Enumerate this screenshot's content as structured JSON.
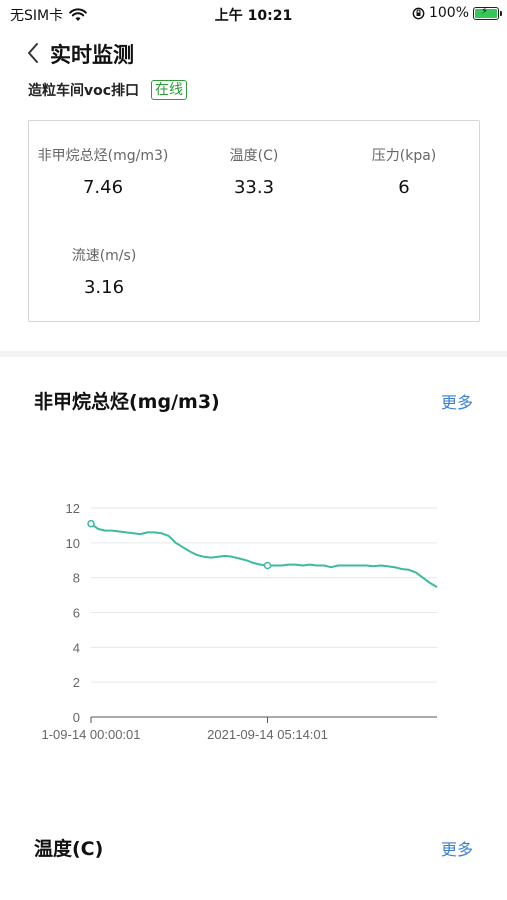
{
  "status_bar": {
    "carrier": "无SIM卡",
    "time": "上午 10:21",
    "battery": "100%",
    "battery_level": 1.0
  },
  "nav": {
    "title": "实时监测"
  },
  "site": {
    "name": "造粒车间voc排口",
    "status": "在线"
  },
  "metrics": [
    {
      "label": "非甲烷总烃(mg/m3)",
      "value": "7.46"
    },
    {
      "label": "温度(C)",
      "value": "33.3"
    },
    {
      "label": "压力(kpa)",
      "value": "6"
    },
    {
      "label": "流速(m/s)",
      "value": "3.16"
    }
  ],
  "sections": [
    {
      "title": "非甲烷总烃(mg/m3)",
      "more": "更多"
    },
    {
      "title": "温度(C)",
      "more": "更多"
    }
  ],
  "chart_data": {
    "type": "line",
    "ylim": [
      0,
      12
    ],
    "yticks": [
      "0",
      "2",
      "4",
      "6",
      "8",
      "10",
      "12"
    ],
    "xtick_labels": [
      "1-09-14 00:00:01",
      "2021-09-14 05:14:01"
    ],
    "grid": true,
    "color": "#3dbaa0",
    "values": [
      11.1,
      10.8,
      10.7,
      10.7,
      10.65,
      10.6,
      10.55,
      10.5,
      10.6,
      10.6,
      10.55,
      10.4,
      10.0,
      9.75,
      9.5,
      9.3,
      9.2,
      9.15,
      9.2,
      9.25,
      9.2,
      9.1,
      9.0,
      8.85,
      8.75,
      8.7,
      8.7,
      8.7,
      8.75,
      8.75,
      8.7,
      8.75,
      8.7,
      8.7,
      8.6,
      8.7,
      8.7,
      8.7,
      8.7,
      8.7,
      8.65,
      8.7,
      8.65,
      8.6,
      8.5,
      8.45,
      8.3,
      8.0,
      7.7,
      7.46
    ],
    "markers": [
      0,
      25
    ]
  }
}
